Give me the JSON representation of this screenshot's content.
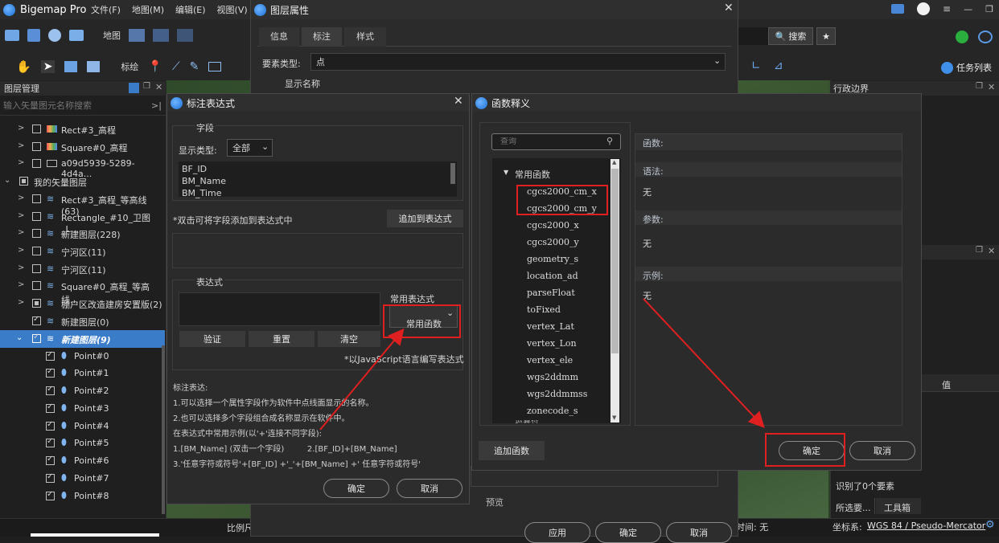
{
  "app": {
    "title": "Bigemap Pro",
    "menus": [
      "文件(F)",
      "地图(M)",
      "编辑(E)",
      "视图(V)"
    ]
  },
  "toolbar": {
    "map_label": "地图",
    "mark_label": "标绘",
    "search_btn": "搜索",
    "task_list": "任务列表"
  },
  "layer_panel": {
    "title": "图层管理",
    "search_placeholder": "输入矢量图元名称搜索",
    "rows": [
      {
        "label": "Rect#3_高程"
      },
      {
        "label": "Square#0_高程"
      },
      {
        "label": "a09d5939-5289-4d4a..."
      },
      {
        "label": "我的矢量图层"
      },
      {
        "label": "Rect#3_高程_等高线(63)"
      },
      {
        "label": "Rectangle_#10_卫图_L..."
      },
      {
        "label": "新建图层(228)"
      },
      {
        "label": "宁河区(11)"
      },
      {
        "label": "宁河区(11)"
      },
      {
        "label": "Square#0_高程_等高线..."
      },
      {
        "label": "棚户区改造建房安置版(2)"
      },
      {
        "label": "新建图层(0)"
      },
      {
        "label": "新建图层(9)"
      },
      {
        "label": "Point#0"
      },
      {
        "label": "Point#1"
      },
      {
        "label": "Point#2"
      },
      {
        "label": "Point#3"
      },
      {
        "label": "Point#4"
      },
      {
        "label": "Point#5"
      },
      {
        "label": "Point#6"
      },
      {
        "label": "Point#7"
      },
      {
        "label": "Point#8"
      }
    ]
  },
  "right_panel": {
    "title": "行政边界",
    "value_header": "值",
    "identified": "识别了0个要素",
    "tab1": "所选要...",
    "tab2": "工具箱"
  },
  "statusbar": {
    "scale": "比例尺",
    "time": "时间: 无",
    "coord_label": "坐标系:",
    "coord_value": "WGS 84 / Pseudo-Mercator"
  },
  "layer_props": {
    "title": "图层属性",
    "tabs": [
      "信息",
      "标注",
      "样式"
    ],
    "feature_type_label": "要素类型:",
    "feature_type": "点",
    "display_name": "显示名称",
    "preview": "预览",
    "btn_apply": "应用",
    "btn_ok": "确定",
    "btn_cancel": "取消"
  },
  "label_expr": {
    "title": "标注表达式",
    "field_section": "字段",
    "display_type_label": "显示类型:",
    "display_type": "全部",
    "fields": [
      "BF_ID",
      "BM_Name",
      "BM_Time"
    ],
    "hint": "*双击可将字段添加到表达式中",
    "add_to_expr": "追加到表达式",
    "expr_section": "表达式",
    "common_expr": "常用表达式",
    "common_funcs": "常用函数",
    "btn_verify": "验证",
    "btn_reset": "重置",
    "btn_clear": "清空",
    "js_hint": "*以JavaScript语言编写表达式",
    "help": [
      "标注表达:",
      "1.可以选择一个属性字段作为软件中点线面显示的名称。",
      "2.也可以选择多个字段组合成名称显示在软件中。",
      "在表达式中常用示例(以'+'连接不同字段):",
      "1.[BM_Name] (双击一个字段)         2.[BF_ID]+[BM_Name]",
      "3.'任意字符或符号'+[BF_ID] +'_'+[BM_Name] +' 任意字符或符号'"
    ],
    "btn_ok": "确定",
    "btn_cancel": "取消"
  },
  "func_dlg": {
    "title": "函数释义",
    "search_placeholder": "查询",
    "group": "常用函数",
    "funcs": [
      "cgcs2000_cm_x",
      "cgcs2000_cm_y",
      "cgcs2000_x",
      "cgcs2000_y",
      "geometry_s",
      "location_ad",
      "parseFloat",
      "toFixed",
      "vertex_Lat",
      "vertex_Lon",
      "vertex_ele",
      "wgs2ddmm",
      "wgs2ddmmss",
      "zonecode_s"
    ],
    "group2": "运算符",
    "func_label": "函数:",
    "syntax_label": "语法:",
    "syntax_value": "无",
    "param_label": "参数:",
    "param_value": "无",
    "example_label": "示例:",
    "example_value": "无",
    "add_func": "追加函数",
    "btn_ok": "确定",
    "btn_cancel": "取消"
  },
  "colors": {
    "accent": "#2f6fb8",
    "highlight": "#e02020",
    "selected": "#3b7cc9"
  }
}
